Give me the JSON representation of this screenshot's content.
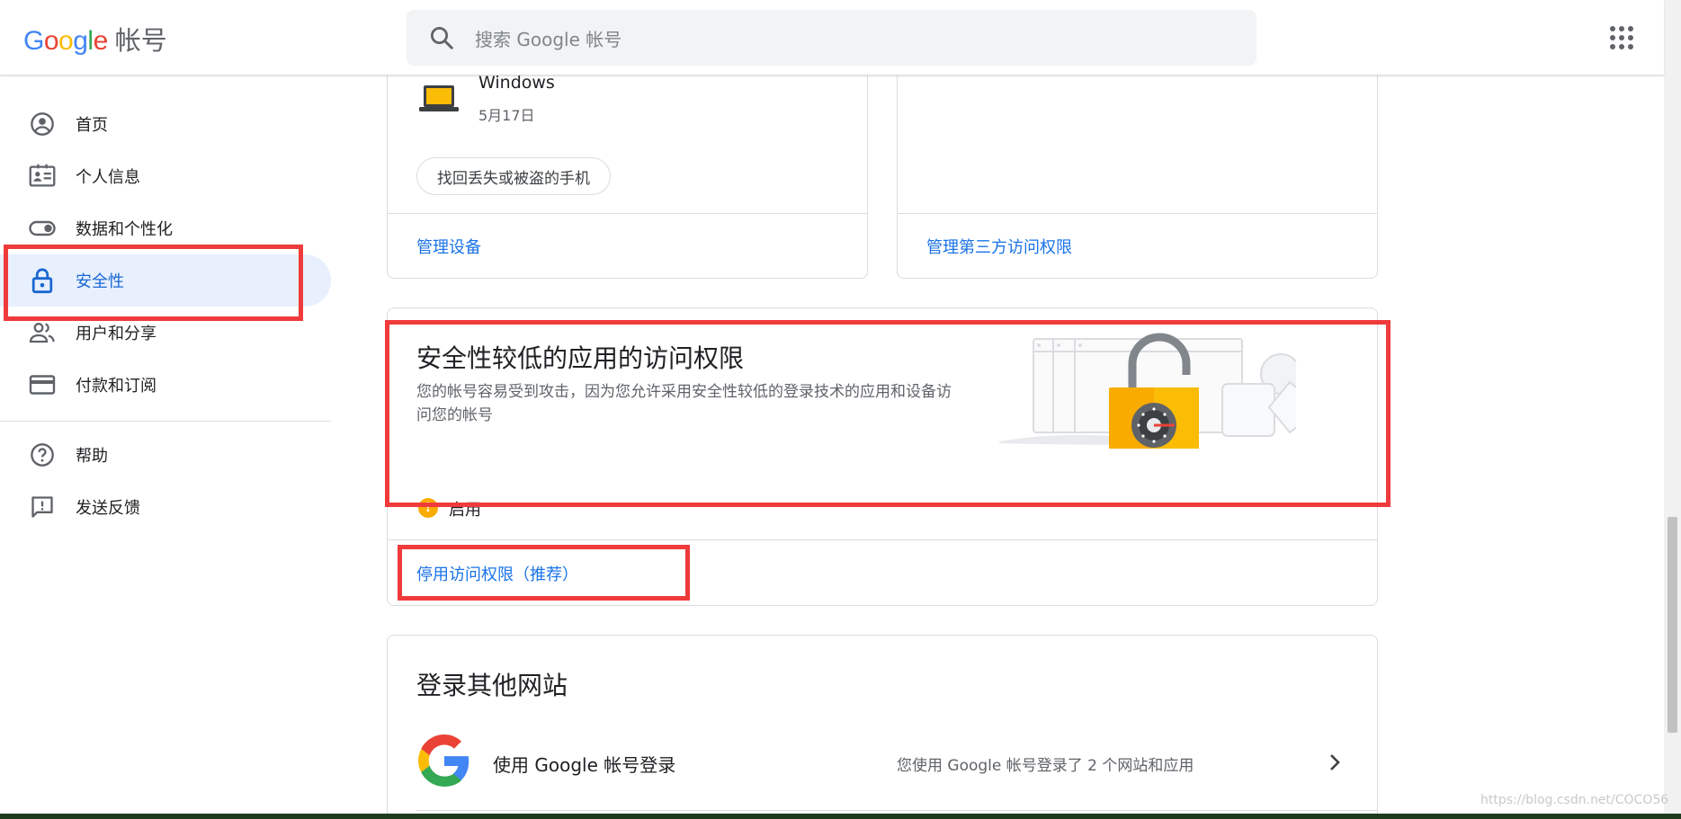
{
  "header": {
    "logo_letters": [
      "G",
      "o",
      "o",
      "g",
      "l",
      "e"
    ],
    "logo_suffix": "帐号",
    "search_placeholder": "搜索 Google 帐号"
  },
  "sidebar": {
    "items": [
      {
        "label": "首页",
        "icon": "account-circle-icon"
      },
      {
        "label": "个人信息",
        "icon": "id-card-icon"
      },
      {
        "label": "数据和个性化",
        "icon": "toggle-icon"
      },
      {
        "label": "安全性",
        "icon": "lock-icon",
        "active": true
      },
      {
        "label": "用户和分享",
        "icon": "people-icon"
      },
      {
        "label": "付款和订阅",
        "icon": "credit-card-icon"
      }
    ],
    "footer_items": [
      {
        "label": "帮助",
        "icon": "help-icon"
      },
      {
        "label": "发送反馈",
        "icon": "feedback-icon"
      }
    ]
  },
  "devices_card": {
    "device_name": "Windows",
    "device_date": "5月17日",
    "find_phone_button": "找回丢失或被盗的手机",
    "manage_link": "管理设备"
  },
  "third_party_card": {
    "manage_link": "管理第三方访问权限"
  },
  "less_secure_card": {
    "title": "安全性较低的应用的访问权限",
    "description": "您的帐号容易受到攻击，因为您允许采用安全性较低的登录技术的应用和设备访问您的帐号",
    "status_icon": "!",
    "status_text": "启用",
    "disable_link": "停用访问权限（推荐）"
  },
  "other_sites_card": {
    "title": "登录其他网站",
    "row_title": "使用 Google 帐号登录",
    "row_desc": "您使用 Google 帐号登录了 2 个网站和应用"
  },
  "watermark": "https://blog.csdn.net/COCO56",
  "colors": {
    "accent": "#1a73e8",
    "active_bg": "#e8f0fe",
    "annotation_red": "#ef3b3b",
    "warning": "#f9ab00"
  }
}
